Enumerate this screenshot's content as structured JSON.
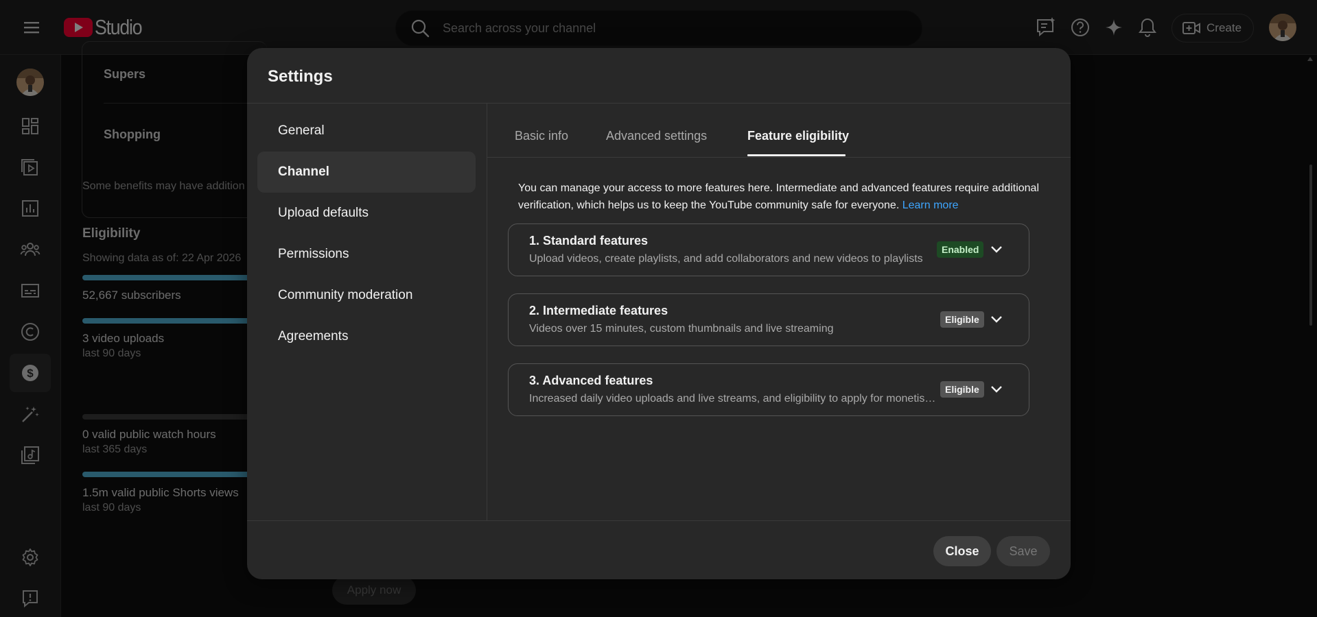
{
  "topbar": {
    "logo_text": "Studio",
    "search_placeholder": "Search across your channel",
    "create_label": "Create",
    "icons": [
      "menu-icon",
      "feedback-icon",
      "help-icon",
      "sparkle-icon",
      "bell-icon",
      "create-video-icon"
    ]
  },
  "rail": {
    "items": [
      "dashboard",
      "content",
      "analytics",
      "community",
      "subtitles",
      "copyright",
      "earn",
      "customization",
      "audio-library",
      "settings",
      "send-feedback"
    ]
  },
  "background": {
    "supers": "Supers",
    "shopping": "Shopping",
    "benefits_note": "Some benefits may have addition",
    "eligibility_title": "Eligibility",
    "showing_data": "Showing data as of: 22 Apr 2026",
    "subscribers": "52,667 subscribers",
    "video_uploads": "3 video uploads",
    "video_uploads_period": "last 90 days",
    "watch_hours": "0 valid public watch hours",
    "watch_hours_period": "last 365 days",
    "shorts_views": "1.5m valid public Shorts views",
    "shorts_views_period": "last 90 days",
    "apply_now": "Apply now"
  },
  "dialog": {
    "title": "Settings",
    "nav": [
      "General",
      "Channel",
      "Upload defaults",
      "Permissions",
      "Community moderation",
      "Agreements"
    ],
    "nav_active": "Channel",
    "tabs": {
      "basic": "Basic info",
      "advanced": "Advanced settings",
      "eligibility": "Feature eligibility"
    },
    "intro": "You can manage your access to more features here. Intermediate and advanced features require additional verification, which helps us to keep the YouTube community safe for everyone.",
    "learn_more": "Learn more",
    "features": [
      {
        "title": "1. Standard features",
        "desc": "Upload videos, create playlists, and add collaborators and new videos to playlists",
        "status": "Enabled"
      },
      {
        "title": "2. Intermediate features",
        "desc": "Videos over 15 minutes, custom thumbnails and live streaming",
        "status": "Eligible"
      },
      {
        "title": "3. Advanced features",
        "desc": "Increased daily video uploads and live streams, and eligibility to apply for monetisation",
        "status": "Eligible"
      }
    ],
    "close_label": "Close",
    "save_label": "Save"
  },
  "colors": {
    "background": "#0f0f0f",
    "surface": "#1f1f1f",
    "dialog": "#282828",
    "accent_link": "#3ea6ff",
    "brand_red": "#ff0033",
    "enabled_badge": "#1d4a24",
    "eligible_badge": "#555555"
  }
}
